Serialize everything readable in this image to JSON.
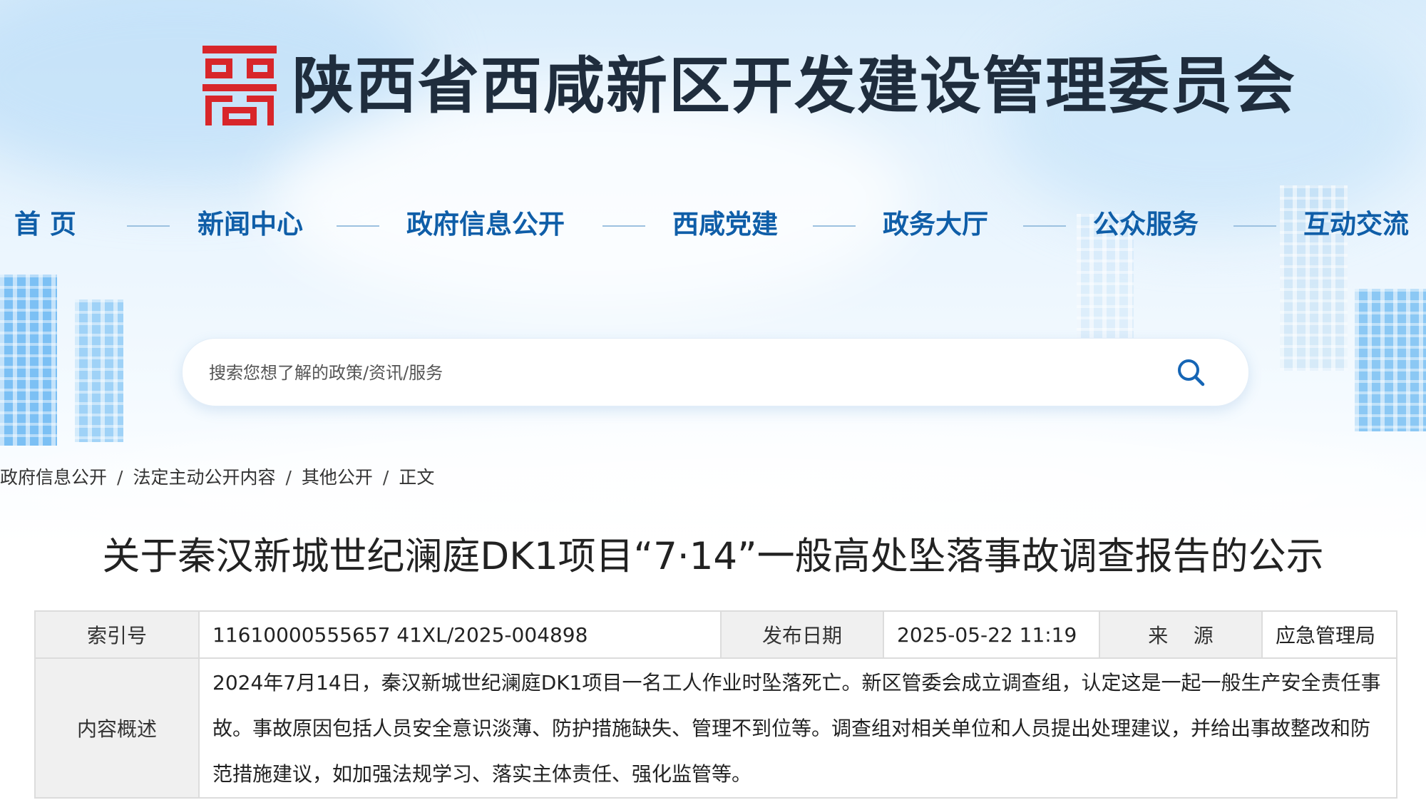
{
  "site": {
    "title": "陕西省西咸新区开发建设管理委员会"
  },
  "colors": {
    "brand_red": "#d8262a",
    "nav_blue": "#0f5ea8",
    "title_dark": "#1f2d3d"
  },
  "nav": {
    "items": [
      {
        "label": "首  页"
      },
      {
        "label": "新闻中心"
      },
      {
        "label": "政府信息公开"
      },
      {
        "label": "西咸党建"
      },
      {
        "label": "政务大厅"
      },
      {
        "label": "公众服务"
      },
      {
        "label": "互动交流"
      }
    ]
  },
  "search": {
    "placeholder": "搜索您想了解的政策/资讯/服务",
    "icon": "search-icon"
  },
  "breadcrumb": {
    "items": [
      "政府信息公开",
      "法定主动公开内容",
      "其他公开",
      "正文"
    ],
    "separator": "/"
  },
  "article": {
    "title": "关于秦汉新城世纪澜庭DK1项目“7·14”一般高处坠落事故调查报告的公示"
  },
  "meta": {
    "index_label": "索引号",
    "index_value": "11610000555657 41XL/2025-004898",
    "date_label": "发布日期",
    "date_value": "2025-05-22 11:19",
    "source_label": "来    源",
    "source_value": "应急管理局",
    "summary_label": "内容概述",
    "summary_value": "2024年7月14日，秦汉新城世纪澜庭DK1项目一名工人作业时坠落死亡。新区管委会成立调查组，认定这是一起一般生产安全责任事故。事故原因包括人员安全意识淡薄、防护措施缺失、管理不到位等。调查组对相关单位和人员提出处理建议，并给出事故整改和防范措施建议，如加强法规学习、落实主体责任、强化监管等。"
  }
}
